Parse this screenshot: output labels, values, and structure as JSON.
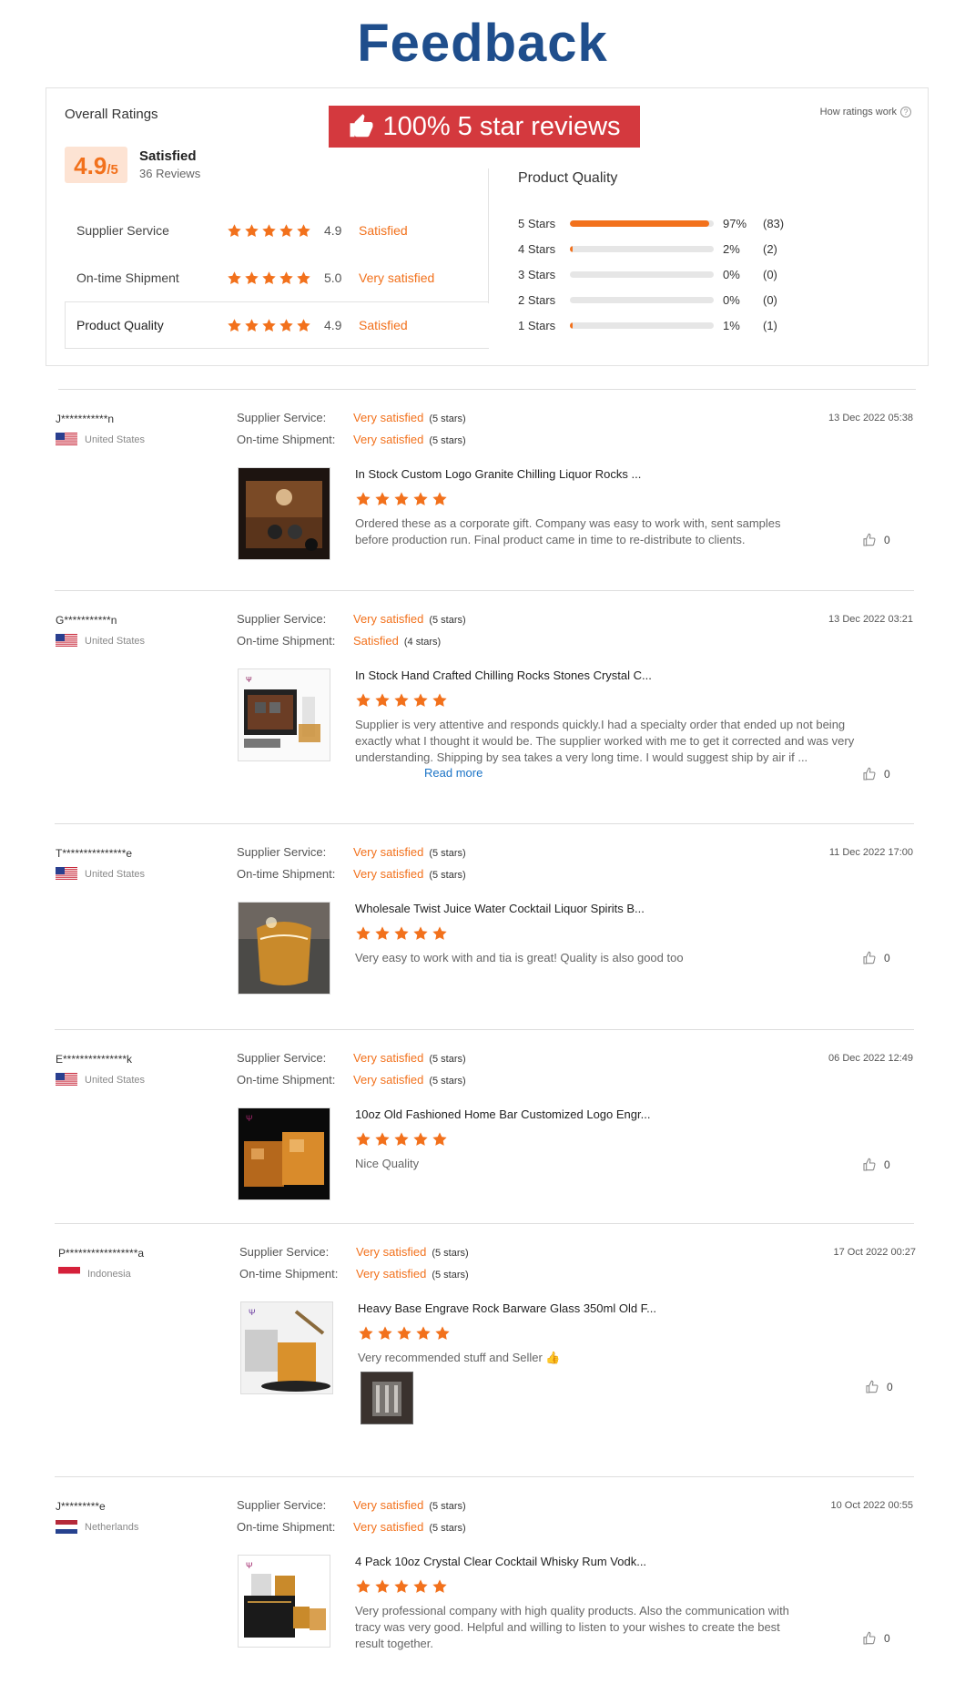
{
  "page_title": "Feedback",
  "overall": {
    "title": "Overall Ratings",
    "banner_text": "100% 5 star reviews",
    "how_ratings_work": "How ratings work",
    "score": "4.9",
    "score_suffix": "/5",
    "satisfaction": "Satisfied",
    "reviews": "36 Reviews",
    "categories": [
      {
        "name": "Supplier Service",
        "value": "4.9",
        "desc": "Satisfied",
        "stars": 5
      },
      {
        "name": "On-time Shipment",
        "value": "5.0",
        "desc": "Very satisfied",
        "stars": 5
      },
      {
        "name": "Product Quality",
        "value": "4.9",
        "desc": "Satisfied",
        "stars": 5
      }
    ]
  },
  "product_quality": {
    "title": "Product Quality",
    "rows": [
      {
        "label": "5 Stars",
        "pct": "97%",
        "count": "(83)",
        "fill": 0.97
      },
      {
        "label": "4 Stars",
        "pct": "2%",
        "count": "(2)",
        "fill": 0.02
      },
      {
        "label": "3 Stars",
        "pct": "0%",
        "count": "(0)",
        "fill": 0
      },
      {
        "label": "2 Stars",
        "pct": "0%",
        "count": "(0)",
        "fill": 0
      },
      {
        "label": "1 Stars",
        "pct": "1%",
        "count": "(1)",
        "fill": 0.01
      }
    ]
  },
  "labels": {
    "supplier_service": "Supplier Service:",
    "ontime_shipment": "On-time Shipment:",
    "read_more": "Read more"
  },
  "reviews": [
    {
      "user": "J***********n",
      "country": "United States",
      "flag": "us",
      "service": "Very satisfied",
      "service_stars": "(5 stars)",
      "shipment": "Very satisfied",
      "shipment_stars": "(5 stars)",
      "date": "13 Dec 2022 05:38",
      "product": "In Stock Custom Logo Granite Chilling Liquor Rocks ...",
      "text": "Ordered these as a corporate gift. Company was easy to work with, sent samples before production run. Final product came in time to re-distribute to clients.",
      "likes": "0",
      "thumb": "wood-box"
    },
    {
      "user": "G***********n",
      "country": "United States",
      "flag": "us",
      "service": "Very satisfied",
      "service_stars": "(5 stars)",
      "shipment": "Satisfied",
      "shipment_stars": "(4 stars)",
      "date": "13 Dec 2022 03:21",
      "product": "In Stock Hand Crafted Chilling Rocks Stones Crystal C...",
      "text": "Supplier is very attentive and responds quickly.I had a specialty order that ended up not being exactly what I thought it would be. The supplier worked with me to get it corrected and was very understanding.  Shipping by sea takes a very long time. I would suggest ship by air if ...",
      "likes": "0",
      "thumb": "gift-set",
      "read_more": true
    },
    {
      "user": "T***************e",
      "country": "United States",
      "flag": "us",
      "service": "Very satisfied",
      "service_stars": "(5 stars)",
      "shipment": "Very satisfied",
      "shipment_stars": "(5 stars)",
      "date": "11 Dec 2022 17:00",
      "product": "Wholesale Twist Juice Water Cocktail Liquor Spirits B...",
      "text": "Very easy to work with and tia is great!  Quality is also good too",
      "likes": "0",
      "thumb": "twist-glass"
    },
    {
      "user": "E***************k",
      "country": "United States",
      "flag": "us",
      "service": "Very satisfied",
      "service_stars": "(5 stars)",
      "shipment": "Very satisfied",
      "shipment_stars": "(5 stars)",
      "date": "06 Dec 2022 12:49",
      "product": "10oz Old Fashioned Home Bar Customized Logo Engr...",
      "text": "Nice Quality",
      "likes": "0",
      "thumb": "whisky-dark"
    },
    {
      "user": "P*****************a",
      "country": "Indonesia",
      "flag": "id",
      "service": "Very satisfied",
      "service_stars": "(5 stars)",
      "shipment": "Very satisfied",
      "shipment_stars": "(5 stars)",
      "date": "17 Oct 2022 00:27",
      "product": "Heavy Base Engrave Rock Barware Glass 350ml Old F...",
      "text": "Very recommended stuff and Seller 👍",
      "likes": "0",
      "thumb": "rock-glass",
      "photo": true
    },
    {
      "user": "J*********e",
      "country": "Netherlands",
      "flag": "nl",
      "service": "Very satisfied",
      "service_stars": "(5 stars)",
      "shipment": "Very satisfied",
      "shipment_stars": "(5 stars)",
      "date": "10 Oct 2022 00:55",
      "product": "4 Pack 10oz Crystal Clear Cocktail Whisky Rum Vodk...",
      "text": "Very professional company with high quality products. Also the communication with tracy was very good. Helpful and willing to listen to your wishes to create the best result together.",
      "likes": "0",
      "thumb": "four-pack"
    }
  ],
  "colors": {
    "accent": "#f2711c",
    "title": "#1f4e8c",
    "banner": "#d4393e",
    "link": "#1a73c6"
  }
}
